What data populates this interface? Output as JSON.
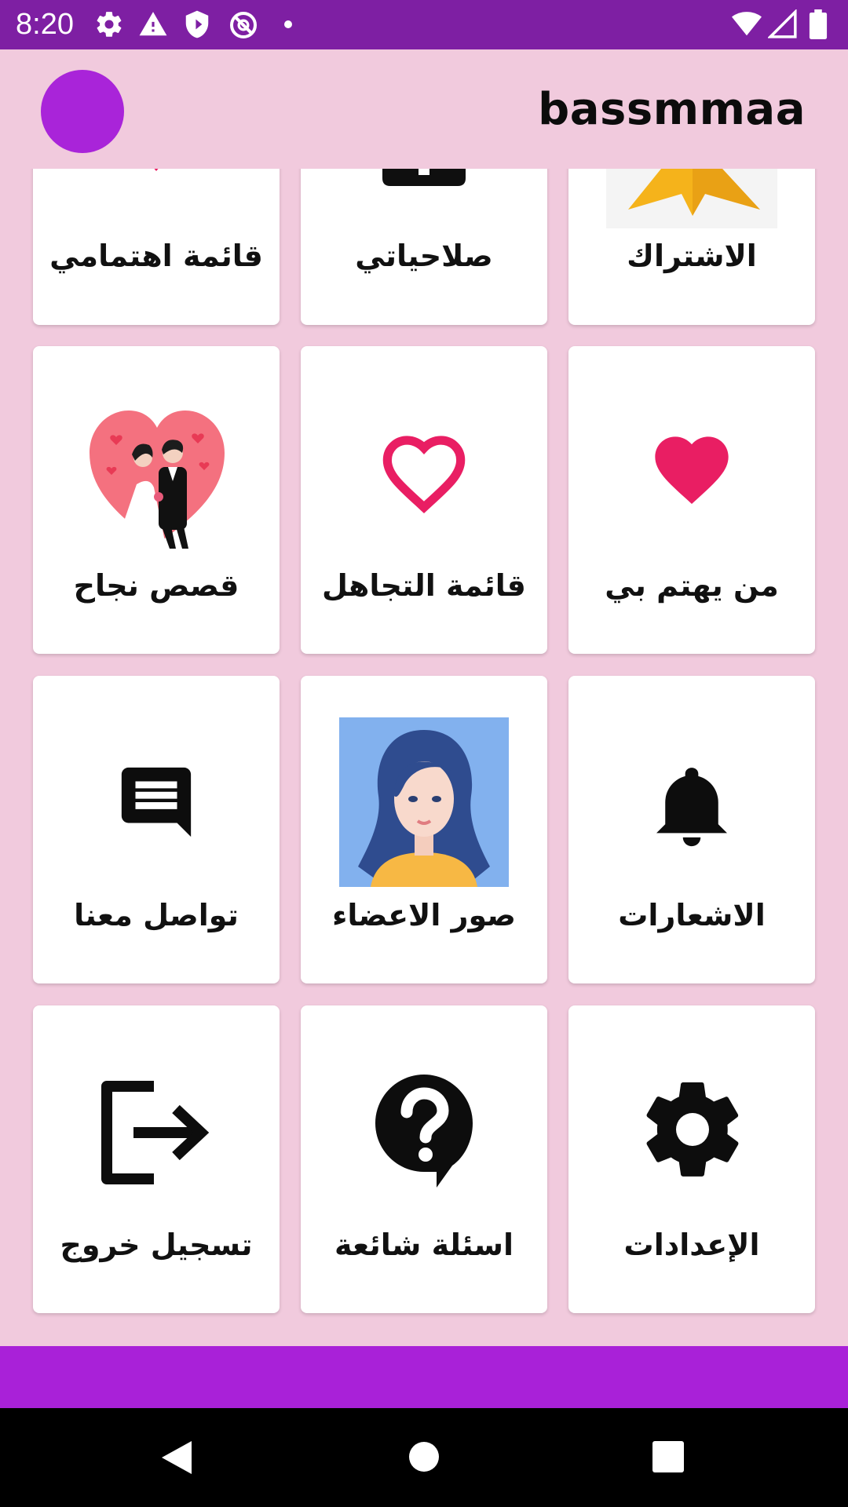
{
  "status_bar": {
    "time": "8:20"
  },
  "header": {
    "title": "bassmmaa"
  },
  "menu": {
    "items": [
      {
        "label": "قائمة اهتمامي",
        "icon": "heart-icon"
      },
      {
        "label": "صلاحياتي",
        "icon": "permissions-icon"
      },
      {
        "label": "الاشتراك",
        "icon": "star-icon"
      },
      {
        "label": "قصص نجاح",
        "icon": "couple-heart-icon"
      },
      {
        "label": "قائمة التجاهل",
        "icon": "heart-outline-icon"
      },
      {
        "label": "من يهتم بي",
        "icon": "heart-icon"
      },
      {
        "label": "تواصل معنا",
        "icon": "chat-icon"
      },
      {
        "label": "صور الاعضاء",
        "icon": "member-photo-icon"
      },
      {
        "label": "الاشعارات",
        "icon": "bell-icon"
      },
      {
        "label": "تسجيل خروج",
        "icon": "logout-icon"
      },
      {
        "label": "اسئلة شائعة",
        "icon": "help-icon"
      },
      {
        "label": "الإعدادات",
        "icon": "gear-icon"
      }
    ]
  },
  "colors": {
    "status_bar": "#7e1fa3",
    "background": "#f1cadd",
    "avatar": "#a924d9",
    "bottom_bar": "#a921d8",
    "heart": "#e91e63"
  }
}
